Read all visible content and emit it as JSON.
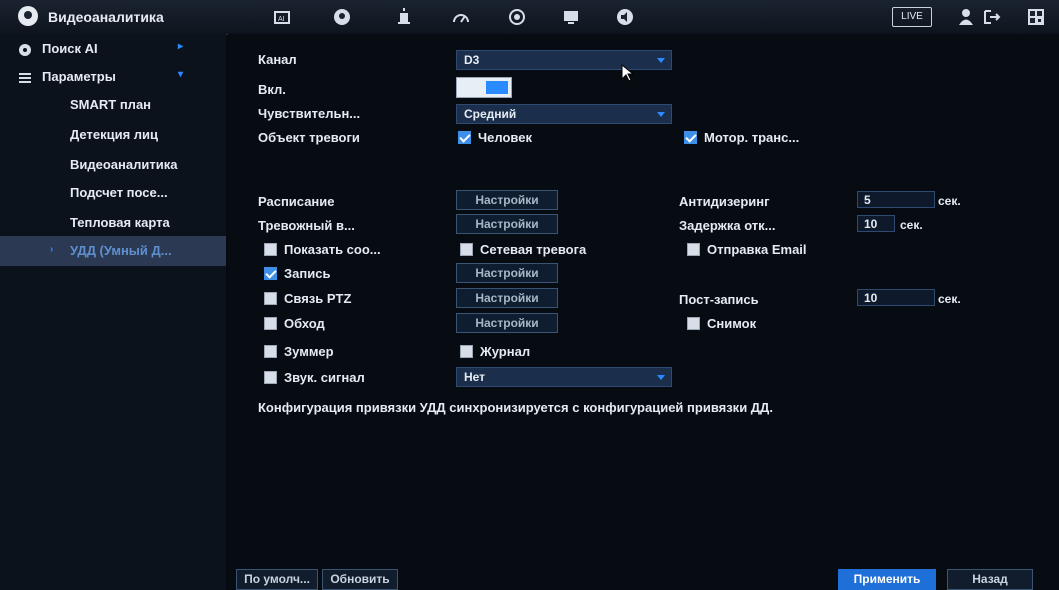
{
  "header": {
    "title": "Видеоаналитика",
    "live_label": "LIVE",
    "icons": [
      "ai-icon",
      "face-icon",
      "alarm-icon",
      "performance-icon",
      "record-icon",
      "display-icon",
      "audio-icon"
    ]
  },
  "sidebar": {
    "items": [
      {
        "label": "Поиск AI"
      },
      {
        "label": "Параметры"
      },
      {
        "label": "SMART план"
      },
      {
        "label": "Детекция лиц"
      },
      {
        "label": "Видеоаналитика"
      },
      {
        "label": "Подсчет посе..."
      },
      {
        "label": "Тепловая карта"
      },
      {
        "label": "УДД (Умный Д..."
      }
    ]
  },
  "form": {
    "channel_label": "Канал",
    "channel_value": "D3",
    "enable_label": "Вкл.",
    "sensitivity_label": "Чувствительн...",
    "sensitivity_value": "Средний",
    "target_label": "Объект тревоги",
    "target_human": "Человек",
    "target_vehicle": "Мотор. транс...",
    "schedule_label": "Расписание",
    "alarm_out_label": "Тревожный в...",
    "settings_label": "Настройки",
    "antidither_label": "Антидизеринг",
    "antidither_value": "5",
    "sec_label": "сек.",
    "delay_label": "Задержка отк...",
    "delay_value": "10",
    "show_msg_label": "Показать соо...",
    "net_alarm_label": "Сетевая тревога",
    "email_label": "Отправка Email",
    "record_label": "Запись",
    "ptz_label": "Связь PTZ",
    "post_record_label": "Пост-запись",
    "post_record_value": "10",
    "tour_label": "Обход",
    "snapshot_label": "Снимок",
    "buzzer_label": "Зуммер",
    "log_label": "Журнал",
    "sound_label": "Звук. сигнал",
    "sound_value": "Нет",
    "note": "Конфигурация привязки УДД синхронизируется с конфигурацией привязки ДД."
  },
  "footer": {
    "default_label": "По умолч...",
    "refresh_label": "Обновить",
    "apply_label": "Применить",
    "back_label": "Назад"
  },
  "colors": {
    "accent": "#2a8bff",
    "apply_bg": "#1f6fd8",
    "sidebar_active": "#2b3a52"
  }
}
